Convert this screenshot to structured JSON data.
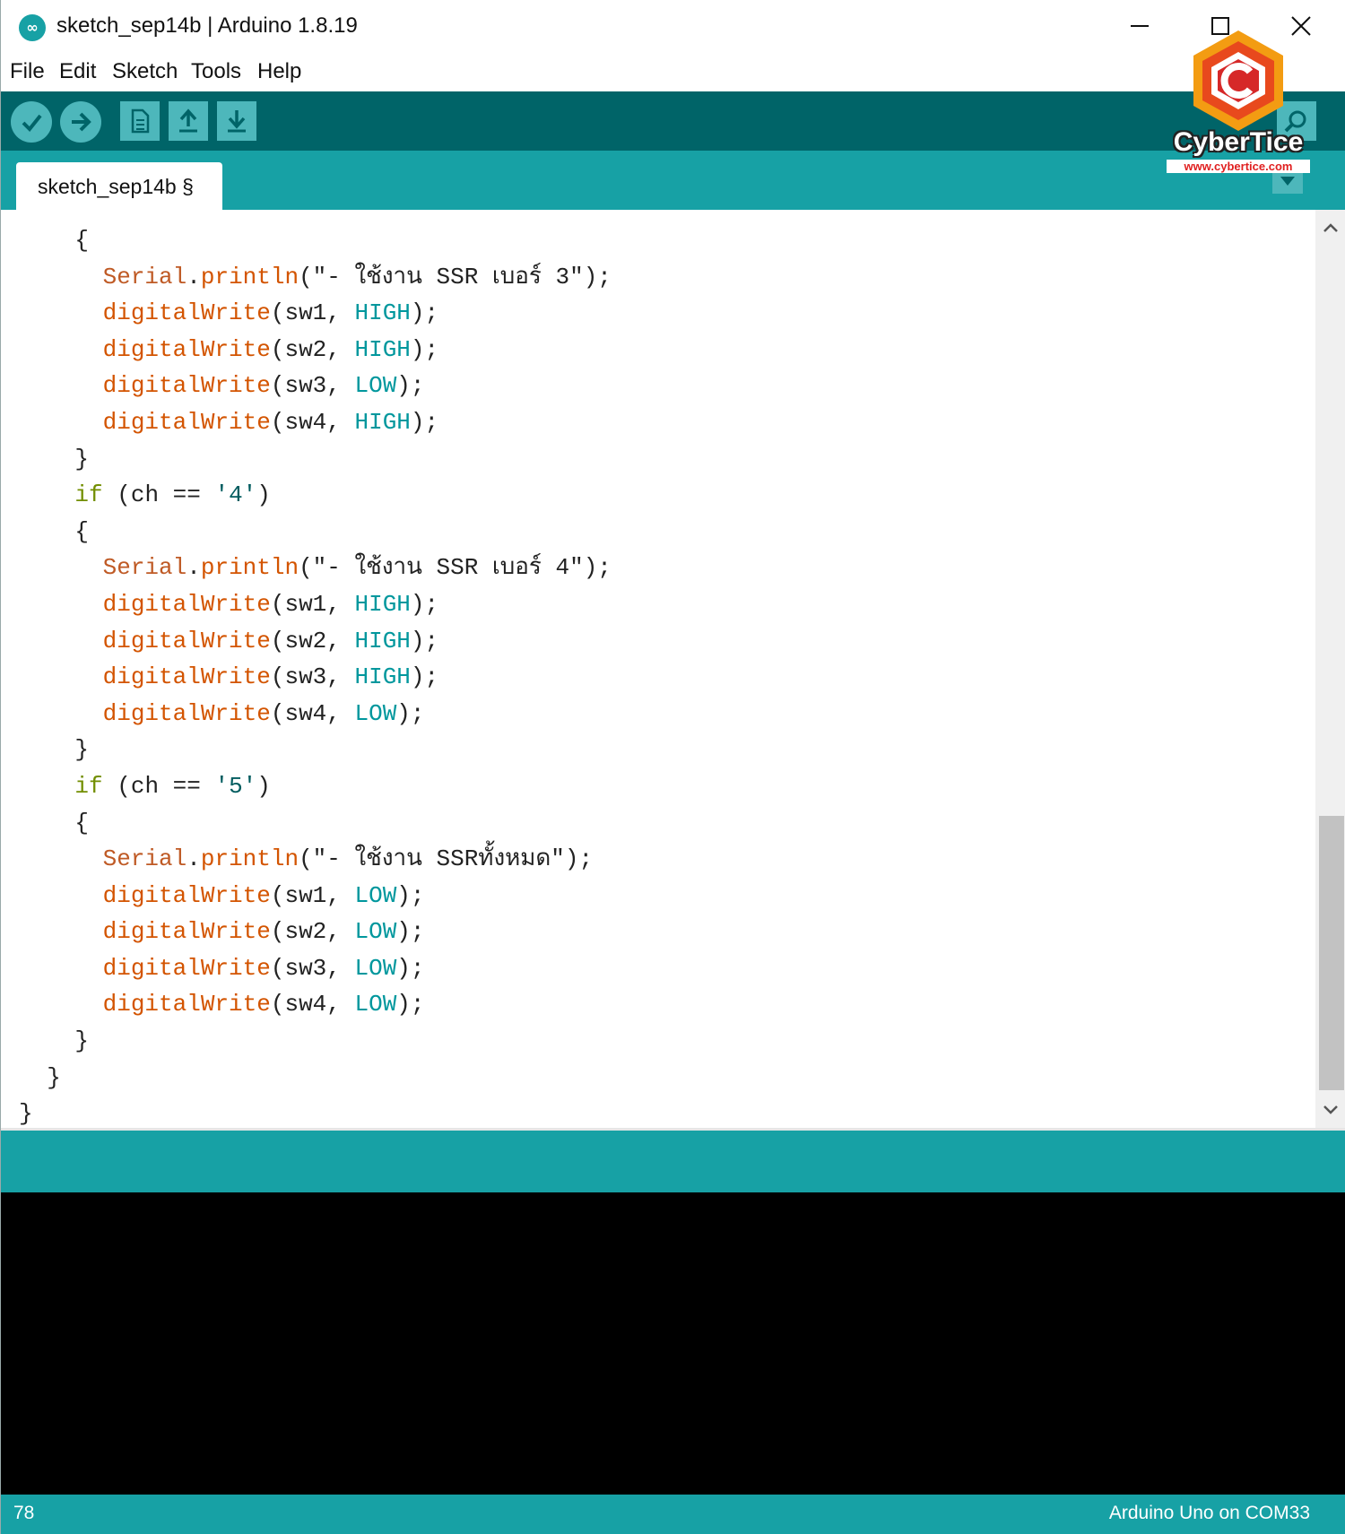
{
  "window": {
    "title": "sketch_sep14b | Arduino 1.8.19",
    "app_icon": "arduino-infinity-icon",
    "app_icon_glyph": "∞"
  },
  "menu": [
    "File",
    "Edit",
    "Sketch",
    "Tools",
    "Help"
  ],
  "toolbar": {
    "buttons": [
      "verify-icon",
      "upload-icon",
      "new-icon",
      "open-icon",
      "save-icon"
    ],
    "serial_monitor": "serial-monitor-icon"
  },
  "tabs": [
    {
      "label": "sketch_sep14b §"
    }
  ],
  "editor": {
    "lines": [
      {
        "indent": "    ",
        "tokens": [
          {
            "t": "{",
            "c": "plain"
          }
        ]
      },
      {
        "indent": "      ",
        "tokens": [
          {
            "t": "Serial",
            "c": "kw"
          },
          {
            "t": ".",
            "c": "plain"
          },
          {
            "t": "println",
            "c": "fn"
          },
          {
            "t": "(\"- ใช้งาน SSR เบอร์ 3\");",
            "c": "plain"
          }
        ]
      },
      {
        "indent": "      ",
        "tokens": [
          {
            "t": "digitalWrite",
            "c": "fn"
          },
          {
            "t": "(sw1, ",
            "c": "plain"
          },
          {
            "t": "HIGH",
            "c": "const"
          },
          {
            "t": ");",
            "c": "plain"
          }
        ]
      },
      {
        "indent": "      ",
        "tokens": [
          {
            "t": "digitalWrite",
            "c": "fn"
          },
          {
            "t": "(sw2, ",
            "c": "plain"
          },
          {
            "t": "HIGH",
            "c": "const"
          },
          {
            "t": ");",
            "c": "plain"
          }
        ]
      },
      {
        "indent": "      ",
        "tokens": [
          {
            "t": "digitalWrite",
            "c": "fn"
          },
          {
            "t": "(sw3, ",
            "c": "plain"
          },
          {
            "t": "LOW",
            "c": "const"
          },
          {
            "t": ");",
            "c": "plain"
          }
        ]
      },
      {
        "indent": "      ",
        "tokens": [
          {
            "t": "digitalWrite",
            "c": "fn"
          },
          {
            "t": "(sw4, ",
            "c": "plain"
          },
          {
            "t": "HIGH",
            "c": "const"
          },
          {
            "t": ");",
            "c": "plain"
          }
        ]
      },
      {
        "indent": "    ",
        "tokens": [
          {
            "t": "}",
            "c": "plain"
          }
        ]
      },
      {
        "indent": "    ",
        "tokens": [
          {
            "t": "if",
            "c": "ctl"
          },
          {
            "t": " (ch == ",
            "c": "plain"
          },
          {
            "t": "'4'",
            "c": "str"
          },
          {
            "t": ")",
            "c": "plain"
          }
        ]
      },
      {
        "indent": "    ",
        "tokens": [
          {
            "t": "{",
            "c": "plain"
          }
        ]
      },
      {
        "indent": "      ",
        "tokens": [
          {
            "t": "Serial",
            "c": "kw"
          },
          {
            "t": ".",
            "c": "plain"
          },
          {
            "t": "println",
            "c": "fn"
          },
          {
            "t": "(\"- ใช้งาน SSR เบอร์ 4\");",
            "c": "plain"
          }
        ]
      },
      {
        "indent": "      ",
        "tokens": [
          {
            "t": "digitalWrite",
            "c": "fn"
          },
          {
            "t": "(sw1, ",
            "c": "plain"
          },
          {
            "t": "HIGH",
            "c": "const"
          },
          {
            "t": ");",
            "c": "plain"
          }
        ]
      },
      {
        "indent": "      ",
        "tokens": [
          {
            "t": "digitalWrite",
            "c": "fn"
          },
          {
            "t": "(sw2, ",
            "c": "plain"
          },
          {
            "t": "HIGH",
            "c": "const"
          },
          {
            "t": ");",
            "c": "plain"
          }
        ]
      },
      {
        "indent": "      ",
        "tokens": [
          {
            "t": "digitalWrite",
            "c": "fn"
          },
          {
            "t": "(sw3, ",
            "c": "plain"
          },
          {
            "t": "HIGH",
            "c": "const"
          },
          {
            "t": ");",
            "c": "plain"
          }
        ]
      },
      {
        "indent": "      ",
        "tokens": [
          {
            "t": "digitalWrite",
            "c": "fn"
          },
          {
            "t": "(sw4, ",
            "c": "plain"
          },
          {
            "t": "LOW",
            "c": "const"
          },
          {
            "t": ");",
            "c": "plain"
          }
        ]
      },
      {
        "indent": "    ",
        "tokens": [
          {
            "t": "}",
            "c": "plain"
          }
        ]
      },
      {
        "indent": "    ",
        "tokens": [
          {
            "t": "if",
            "c": "ctl"
          },
          {
            "t": " (ch == ",
            "c": "plain"
          },
          {
            "t": "'5'",
            "c": "str"
          },
          {
            "t": ")",
            "c": "plain"
          }
        ]
      },
      {
        "indent": "    ",
        "tokens": [
          {
            "t": "{",
            "c": "plain"
          }
        ]
      },
      {
        "indent": "      ",
        "tokens": [
          {
            "t": "Serial",
            "c": "kw"
          },
          {
            "t": ".",
            "c": "plain"
          },
          {
            "t": "println",
            "c": "fn"
          },
          {
            "t": "(\"- ใช้งาน SSRทั้งหมด\");",
            "c": "plain"
          }
        ]
      },
      {
        "indent": "      ",
        "tokens": [
          {
            "t": "digitalWrite",
            "c": "fn"
          },
          {
            "t": "(sw1, ",
            "c": "plain"
          },
          {
            "t": "LOW",
            "c": "const"
          },
          {
            "t": ");",
            "c": "plain"
          }
        ]
      },
      {
        "indent": "      ",
        "tokens": [
          {
            "t": "digitalWrite",
            "c": "fn"
          },
          {
            "t": "(sw2, ",
            "c": "plain"
          },
          {
            "t": "LOW",
            "c": "const"
          },
          {
            "t": ");",
            "c": "plain"
          }
        ]
      },
      {
        "indent": "      ",
        "tokens": [
          {
            "t": "digitalWrite",
            "c": "fn"
          },
          {
            "t": "(sw3, ",
            "c": "plain"
          },
          {
            "t": "LOW",
            "c": "const"
          },
          {
            "t": ");",
            "c": "plain"
          }
        ]
      },
      {
        "indent": "      ",
        "tokens": [
          {
            "t": "digitalWrite",
            "c": "fn"
          },
          {
            "t": "(sw4, ",
            "c": "plain"
          },
          {
            "t": "LOW",
            "c": "const"
          },
          {
            "t": ");",
            "c": "plain"
          }
        ]
      },
      {
        "indent": "    ",
        "tokens": [
          {
            "t": "}",
            "c": "plain"
          }
        ]
      },
      {
        "indent": "  ",
        "tokens": [
          {
            "t": "}",
            "c": "plain"
          }
        ]
      },
      {
        "indent": "",
        "tokens": [
          {
            "t": "}",
            "c": "plain"
          }
        ]
      }
    ]
  },
  "status": {
    "line_number": "78",
    "board_port": "Arduino Uno on COM33"
  },
  "watermark": {
    "name": "CyberTice",
    "url": "www.cybertice.com",
    "logo": "cybertice-hexagon-logo"
  },
  "colors": {
    "toolbar": "#006468",
    "tabstrip": "#17a1a5",
    "button": "#4db7bb",
    "keyword": "#d35400",
    "constant": "#00979d",
    "control": "#728e00",
    "console": "#000000"
  }
}
